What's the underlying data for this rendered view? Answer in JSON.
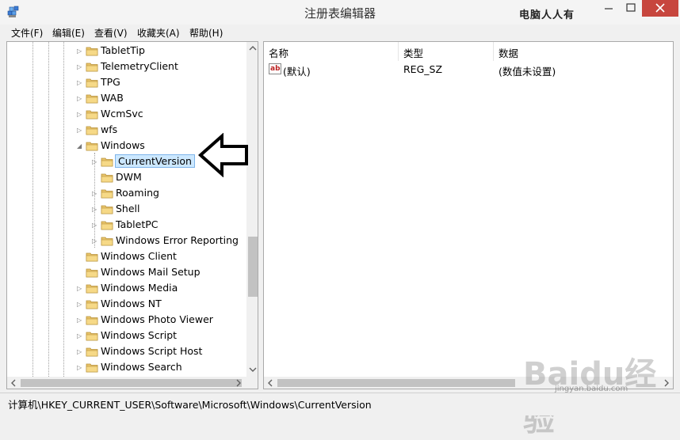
{
  "window": {
    "title": "注册表编辑器",
    "watermark": "电脑人人有",
    "colors": {
      "close_button": "#c7463e",
      "selection_bg": "#cce8ff",
      "selection_border": "#7eb4ea"
    }
  },
  "menu": {
    "items": [
      {
        "label": "文件(F)"
      },
      {
        "label": "编辑(E)"
      },
      {
        "label": "查看(V)"
      },
      {
        "label": "收藏夹(A)"
      },
      {
        "label": "帮助(H)"
      }
    ]
  },
  "tree": {
    "items": [
      {
        "label": "TabletTip",
        "expander": "▷"
      },
      {
        "label": "TelemetryClient",
        "expander": "▷"
      },
      {
        "label": "TPG",
        "expander": "▷"
      },
      {
        "label": "WAB",
        "expander": "▷"
      },
      {
        "label": "WcmSvc",
        "expander": "▷"
      },
      {
        "label": "wfs",
        "expander": "▷"
      },
      {
        "label": "Windows",
        "expander": "◢"
      },
      {
        "label": "CurrentVersion",
        "expander": "▷"
      },
      {
        "label": "DWM",
        "expander": ""
      },
      {
        "label": "Roaming",
        "expander": "▷"
      },
      {
        "label": "Shell",
        "expander": "▷"
      },
      {
        "label": "TabletPC",
        "expander": "▷"
      },
      {
        "label": "Windows Error Reporting",
        "expander": "▷"
      },
      {
        "label": "Windows Client",
        "expander": ""
      },
      {
        "label": "Windows Mail Setup",
        "expander": ""
      },
      {
        "label": "Windows Media",
        "expander": "▷"
      },
      {
        "label": "Windows NT",
        "expander": "▷"
      },
      {
        "label": "Windows Photo Viewer",
        "expander": "▷"
      },
      {
        "label": "Windows Script",
        "expander": "▷"
      },
      {
        "label": "Windows Script Host",
        "expander": "▷"
      },
      {
        "label": "Windows Search",
        "expander": "▷"
      }
    ],
    "selected": "CurrentVersion"
  },
  "list": {
    "columns": {
      "name": "名称",
      "type": "类型",
      "data": "数据"
    },
    "rows": [
      {
        "name": "(默认)",
        "type": "REG_SZ",
        "data": "(数值未设置)",
        "icon": "ab"
      }
    ]
  },
  "status": {
    "path": "计算机\\HKEY_CURRENT_USER\\Software\\Microsoft\\Windows\\CurrentVersion"
  },
  "watermark_bottom": {
    "main": "Baidu经验",
    "sub": "jingyan.baidu.com"
  }
}
